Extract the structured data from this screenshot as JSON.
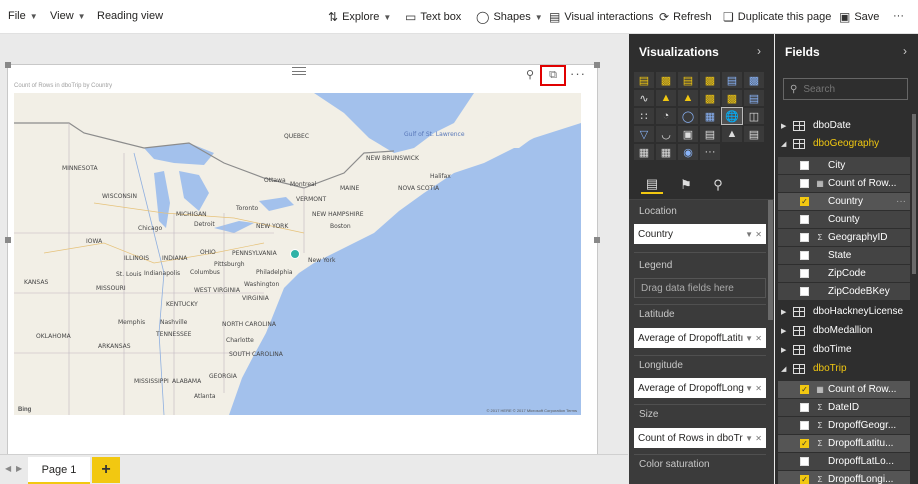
{
  "toolbar": {
    "file": "File",
    "view": "View",
    "reading_view": "Reading view",
    "explore": "Explore",
    "text_box": "Text box",
    "shapes": "Shapes",
    "visual_interactions": "Visual interactions",
    "refresh": "Refresh",
    "duplicate_page": "Duplicate this page",
    "save": "Save",
    "more": "···"
  },
  "visual": {
    "title": "Count of Rows in dboTrip by Country",
    "bing": "Bing",
    "copyright": "© 2017 HERE © 2017 Microsoft Corporation Terms",
    "map_labels": {
      "minnesota": "MINNESOTA",
      "wisconsin": "WISCONSIN",
      "michigan": "MICHIGAN",
      "iowa": "IOWA",
      "illinois": "ILLINOIS",
      "indiana": "INDIANA",
      "ohio": "OHIO",
      "missouri": "MISSOURI",
      "kansas": "KANSAS",
      "kentucky": "KENTUCKY",
      "tennessee": "TENNESSEE",
      "oklahoma": "OKLAHOMA",
      "arkansas": "ARKANSAS",
      "mississippi": "MISSISSIPPI",
      "alabama": "ALABAMA",
      "georgia": "GEORGIA",
      "south_carolina": "SOUTH CAROLINA",
      "north_carolina": "NORTH CAROLINA",
      "virginia": "VIRGINIA",
      "west_virginia": "WEST VIRGINIA",
      "pennsylvania": "PENNSYLVANIA",
      "new_york": "NEW YORK",
      "vermont": "VERMONT",
      "new_hampshire": "NEW HAMPSHIRE",
      "maine": "MAINE",
      "new_brunswick": "NEW BRUNSWICK",
      "nova_scotia": "NOVA SCOTIA",
      "quebec": "QUEBEC",
      "gulf": "Gulf of St. Lawrence",
      "boston": "Boston",
      "new_york_city": "New York",
      "philadelphia": "Philadelphia",
      "washington": "Washington",
      "chicago": "Chicago",
      "detroit": "Detroit",
      "toronto": "Toronto",
      "montreal": "Montreal",
      "ottawa": "Ottawa",
      "indianapolis": "Indianapolis",
      "columbus": "Columbus",
      "pittsburgh": "Pittsburgh",
      "atlanta": "Atlanta",
      "nashville": "Nashville",
      "charlotte": "Charlotte",
      "st_louis": "St. Louis",
      "memphis": "Memphis",
      "halifax": "Halifax"
    }
  },
  "pages": {
    "tab1": "Page 1",
    "add": "+"
  },
  "viz_pane": {
    "title": "Visualizations",
    "location_label": "Location",
    "location_value": "Country",
    "legend_label": "Legend",
    "legend_placeholder": "Drag data fields here",
    "latitude_label": "Latitude",
    "latitude_value": "Average of DropoffLatitı",
    "longitude_label": "Longitude",
    "longitude_value": "Average of DropoffLong",
    "size_label": "Size",
    "size_value": "Count of Rows in dboTr",
    "color_sat_label": "Color saturation"
  },
  "fields_pane": {
    "title": "Fields",
    "search_placeholder": "Search",
    "tables": {
      "dbodate": "dboDate",
      "dbogeography": "dboGeography",
      "dbohackney": "dboHackneyLicense",
      "dbomedallion": "dboMedallion",
      "dbotime": "dboTime",
      "dbotrip": "dboTrip"
    },
    "geo_fields": {
      "city": "City",
      "count_rows": "Count of Row...",
      "country": "Country",
      "county": "County",
      "geography_id": "GeographyID",
      "state": "State",
      "zipcode": "ZipCode",
      "zipcode_bkey": "ZipCodeBKey"
    },
    "trip_fields": {
      "count_rows": "Count of Row...",
      "dateid": "DateID",
      "dropoff_geo": "DropoffGeogr...",
      "dropoff_lat": "DropoffLatitu...",
      "dropoff_lon_a": "DropoffLatLo...",
      "dropoff_lon_b": "DropoffLongi..."
    }
  },
  "colors": {
    "accent": "#f2c811",
    "pane_bg": "#2e2e2e",
    "map_water": "#a3c1ec",
    "map_land": "#f2efe6",
    "focus_box": "#e00000",
    "data_point": "#2fb2a7"
  }
}
